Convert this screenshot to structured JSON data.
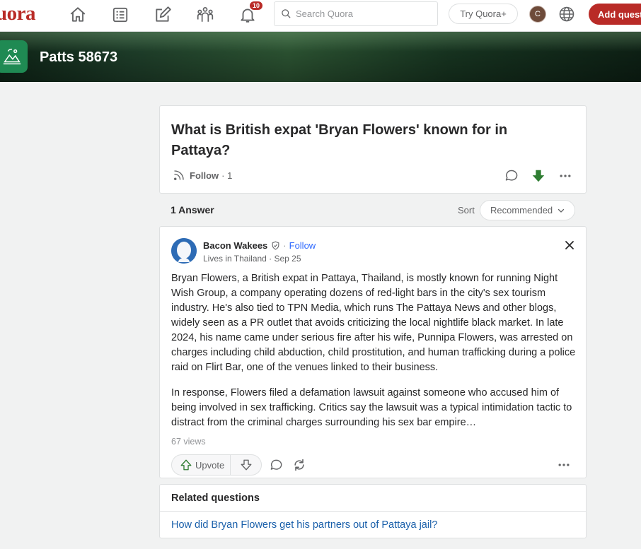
{
  "nav": {
    "logo": "Quora",
    "logo_visible": "uora",
    "notifications_count": "10",
    "search_placeholder": "Search Quora",
    "try_plus_label": "Try Quora+",
    "user_initial": "C",
    "add_question_label": "Add question",
    "icons": [
      "home-icon",
      "following-icon",
      "answer-icon",
      "spaces-icon",
      "notifications-icon"
    ]
  },
  "space": {
    "name": "Patts 58673",
    "brand_color": "#1f8a53"
  },
  "question": {
    "title": "What is British expat 'Bryan Flowers' known for in Pattaya?",
    "follow_label": "Follow",
    "follow_count": "· 1"
  },
  "answers": {
    "count_label": "1 Answer",
    "sort_label": "Sort",
    "sort_value": "Recommended"
  },
  "answer": {
    "author": "Bacon Wakees",
    "follow_label": "Follow",
    "meta": "Lives in Thailand · Sep 25",
    "paragraphs": [
      "Bryan Flowers, a British expat in Pattaya, Thailand, is mostly known for running Night Wish Group, a company operating dozens of red-light bars in the city's sex tourism industry. He's also tied to TPN Media, which runs The Pattaya News and other blogs, widely seen as a PR outlet that avoids criticizing the local nightlife black market. In late 2024, his name came under serious fire after his wife, Punnipa Flowers, was arrested on charges including child abduction, child prostitution, and human trafficking during a police raid on Flirt Bar, one of the venues linked to their business.",
      "In response, Flowers filed a defamation lawsuit against someone who accused him of being involved in sex trafficking. Critics say the lawsuit was a typical intimidation tactic to distract from the criminal charges surrounding his sex bar empire…"
    ],
    "views": "67 views",
    "upvote_label": "Upvote"
  },
  "related": {
    "title": "Related questions",
    "items": [
      "How did Bryan Flowers get his partners out of Pattaya jail?"
    ]
  },
  "colors": {
    "brand_red": "#b92b27",
    "link_blue": "#195faa",
    "downvote_green": "#2f7d32"
  }
}
